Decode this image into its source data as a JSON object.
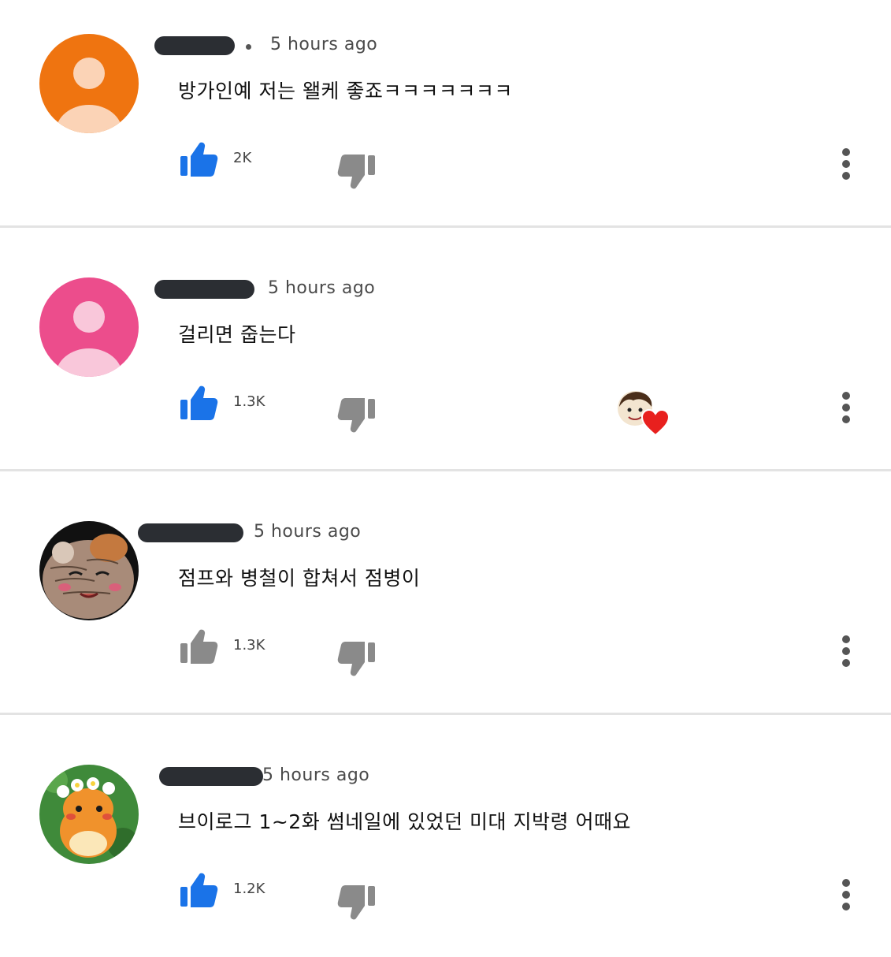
{
  "comments": [
    {
      "time": "5 hours ago",
      "text": "방가인예 저는 왤케 좋죠ㅋㅋㅋㅋㅋㅋㅋ",
      "likes": "2K",
      "liked": true,
      "avatar_color": "#ef7410",
      "avatar_figure_color": "#fbd3b6"
    },
    {
      "time": "5 hours ago",
      "text": "걸리면 줍는다",
      "likes": "1.3K",
      "liked": true,
      "avatar_color": "#ec4d8c",
      "avatar_figure_color": "#f9c7da",
      "creator_heart": true
    },
    {
      "time": "5 hours ago",
      "text": "점프와 병철이 합쳐서 점병이",
      "likes": "1.3K",
      "liked": false
    },
    {
      "time": "5 hours ago",
      "text": "브이로그 1~2화 썸네일에 있었던 미대 지박령 어때요",
      "likes": "1.2K",
      "liked": true
    }
  ],
  "colors": {
    "like_active": "#1a73e8",
    "like_inactive": "#8a8a8a",
    "dislike": "#8a8a8a",
    "heart": "#e8201e"
  },
  "icons": {
    "like": "thumbs-up-icon",
    "dislike": "thumbs-down-icon",
    "more": "more-vert-icon",
    "heart": "heart-icon"
  }
}
